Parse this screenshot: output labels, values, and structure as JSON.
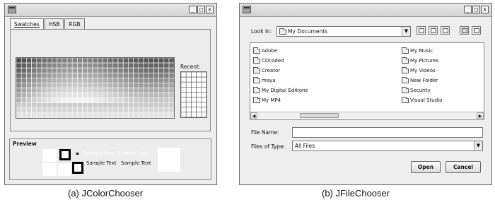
{
  "color_chooser": {
    "tabs": [
      "Swatches",
      "HSB",
      "RGB"
    ],
    "recent_label": "Recent:",
    "preview": {
      "title": "Preview",
      "sample_text_1": "Sample Text",
      "sample_text_2": "Sample Text",
      "sample_text_3": "Sample Text",
      "sample_text_4": "Sample Text"
    },
    "window_buttons": [
      "_",
      "□",
      "×"
    ]
  },
  "file_chooser": {
    "look_in_label": "Look In:",
    "look_in_value": "My Documents",
    "files_left": [
      "Adobe",
      "CDcoded",
      "Creator",
      "maya",
      "My Digital Editions",
      "My MP4"
    ],
    "files_right": [
      "My Music",
      "My Pictures",
      "My Videos",
      "New Folder",
      "Security",
      "Visual Studio"
    ],
    "file_name_label": "File Name:",
    "file_name_value": "",
    "files_of_type_label": "Files of Type:",
    "files_of_type_value": "All Files",
    "open_label": "Open",
    "cancel_label": "Cancel",
    "window_buttons": [
      "_",
      "□",
      "×"
    ]
  },
  "captions": {
    "left": "(a) JColorChooser",
    "right": "(b) JFileChooser"
  }
}
